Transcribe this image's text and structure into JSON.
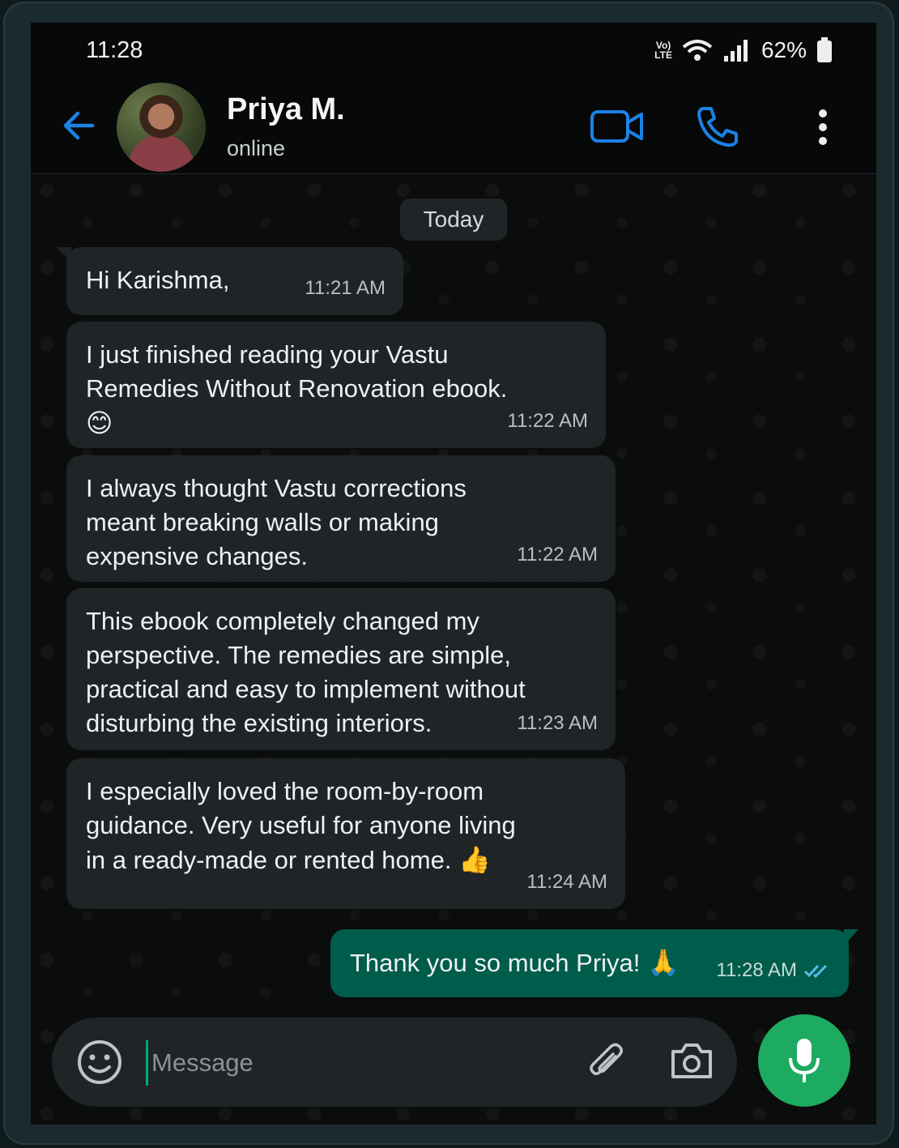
{
  "status_bar": {
    "time": "11:28",
    "network_badge_top": "Vo)",
    "network_badge_bottom": "LTE",
    "battery": "62%"
  },
  "header": {
    "name": "Priya M.",
    "status": "online"
  },
  "chat": {
    "date_chip": "Today",
    "incoming": [
      {
        "text": "Hi Karishma,",
        "time": "11:21 AM"
      },
      {
        "text": "I just finished reading your Vastu\nRemedies Without Renovation ebook.",
        "emoji": "😊",
        "time": "11:22 AM"
      },
      {
        "text": "I always thought Vastu corrections\nmeant breaking walls or making\nexpensive changes.",
        "time": "11:22 AM"
      },
      {
        "text": "This ebook completely changed my\nperspective. The remedies are simple,\npractical and easy to implement without\ndisturbing the existing interiors.",
        "time": "11:23 AM"
      },
      {
        "text": "I especially loved the room-by-room\nguidance. Very useful for anyone living\nin a ready-made or rented home.",
        "emoji": "👍",
        "time": "11:24 AM"
      }
    ],
    "outgoing": [
      {
        "text": "Thank you so much Priya!",
        "emoji": "🙏",
        "time": "11:28 AM",
        "status": "read"
      }
    ]
  },
  "composer": {
    "placeholder": "Message"
  },
  "colors": {
    "accent": "#1b82e8",
    "outgoing_bubble": "#005c4b",
    "incoming_bubble": "#1f2426",
    "mic_button": "#1daa61",
    "read_ticks": "#53bdeb"
  }
}
